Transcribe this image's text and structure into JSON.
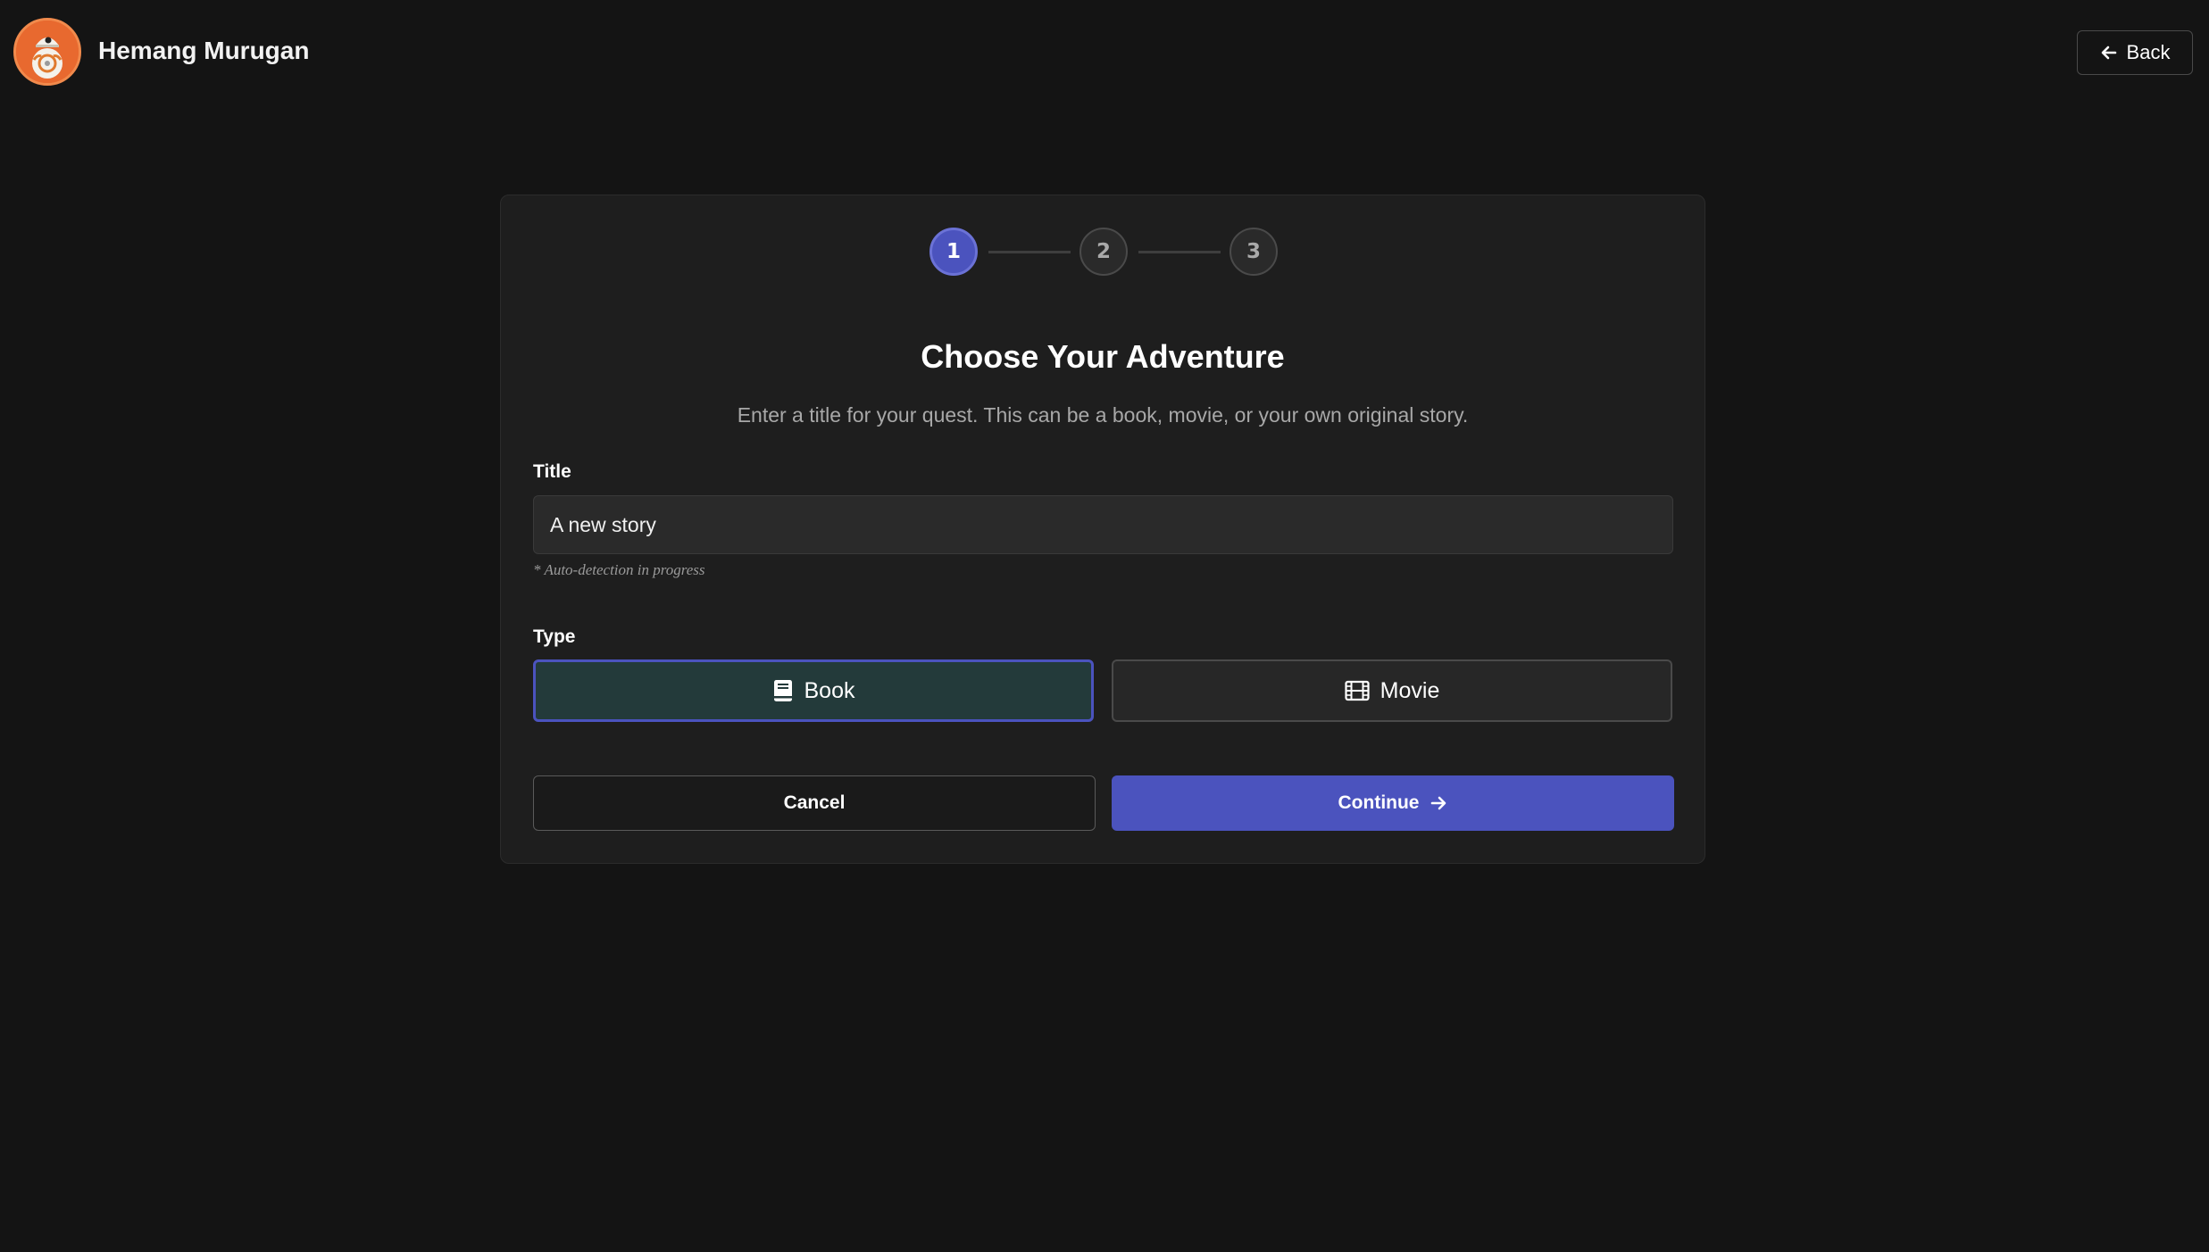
{
  "header": {
    "user_name": "Hemang Murugan",
    "back_label": "Back"
  },
  "stepper": {
    "steps": [
      "1",
      "2",
      "3"
    ],
    "current": 1
  },
  "card": {
    "title": "Choose Your Adventure",
    "subtitle": "Enter a title for your quest. This can be a book, movie, or your own original story.",
    "title_field": {
      "label": "Title",
      "value": "A new story",
      "hint": "* Auto-detection in progress"
    },
    "type_field": {
      "label": "Type",
      "options": [
        {
          "label": "Book",
          "icon": "book-icon",
          "selected": true
        },
        {
          "label": "Movie",
          "icon": "film-icon",
          "selected": false
        }
      ]
    },
    "cancel_label": "Cancel",
    "continue_label": "Continue"
  },
  "colors": {
    "background": "#141414",
    "card": "#1e1e1e",
    "accent": "#4b53be",
    "selected_fill": "#233a3a",
    "avatar": "#e8692f"
  }
}
